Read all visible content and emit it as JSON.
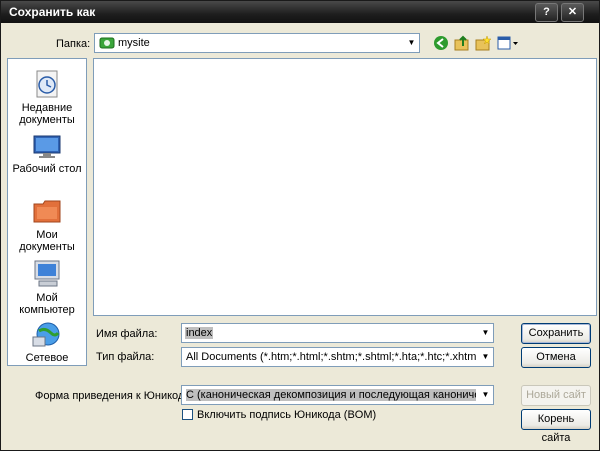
{
  "window": {
    "title": "Сохранить как",
    "help_button": "?",
    "close_button": "✕"
  },
  "lookin": {
    "label": "Папка:",
    "value": "mysite"
  },
  "places": [
    {
      "label": "Недавние документы",
      "icon": "recent-documents-icon"
    },
    {
      "label": "Рабочий стол",
      "icon": "desktop-icon"
    },
    {
      "label": "Мои документы",
      "icon": "my-documents-icon"
    },
    {
      "label": "Мой компьютер",
      "icon": "my-computer-icon"
    },
    {
      "label": "Сетевое",
      "icon": "network-icon"
    }
  ],
  "filename": {
    "label": "Имя файла:",
    "value": "index"
  },
  "filetype": {
    "label": "Тип файла:",
    "value": "All Documents (*.htm;*.html;*.shtm;*.shtml;*.hta;*.htc;*.xhtml;*.stm;*.ssi"
  },
  "unicode": {
    "label": "Форма приведения к Юникоду:",
    "value": "C (каноническая декомпозиция и последующая каноническая"
  },
  "bom": {
    "label": "Включить подпись Юникода (BOM)",
    "checked": false
  },
  "buttons": {
    "save": "Сохранить",
    "cancel": "Отмена",
    "new_site": "Новый сайт",
    "site_root": "Корень сайта"
  }
}
